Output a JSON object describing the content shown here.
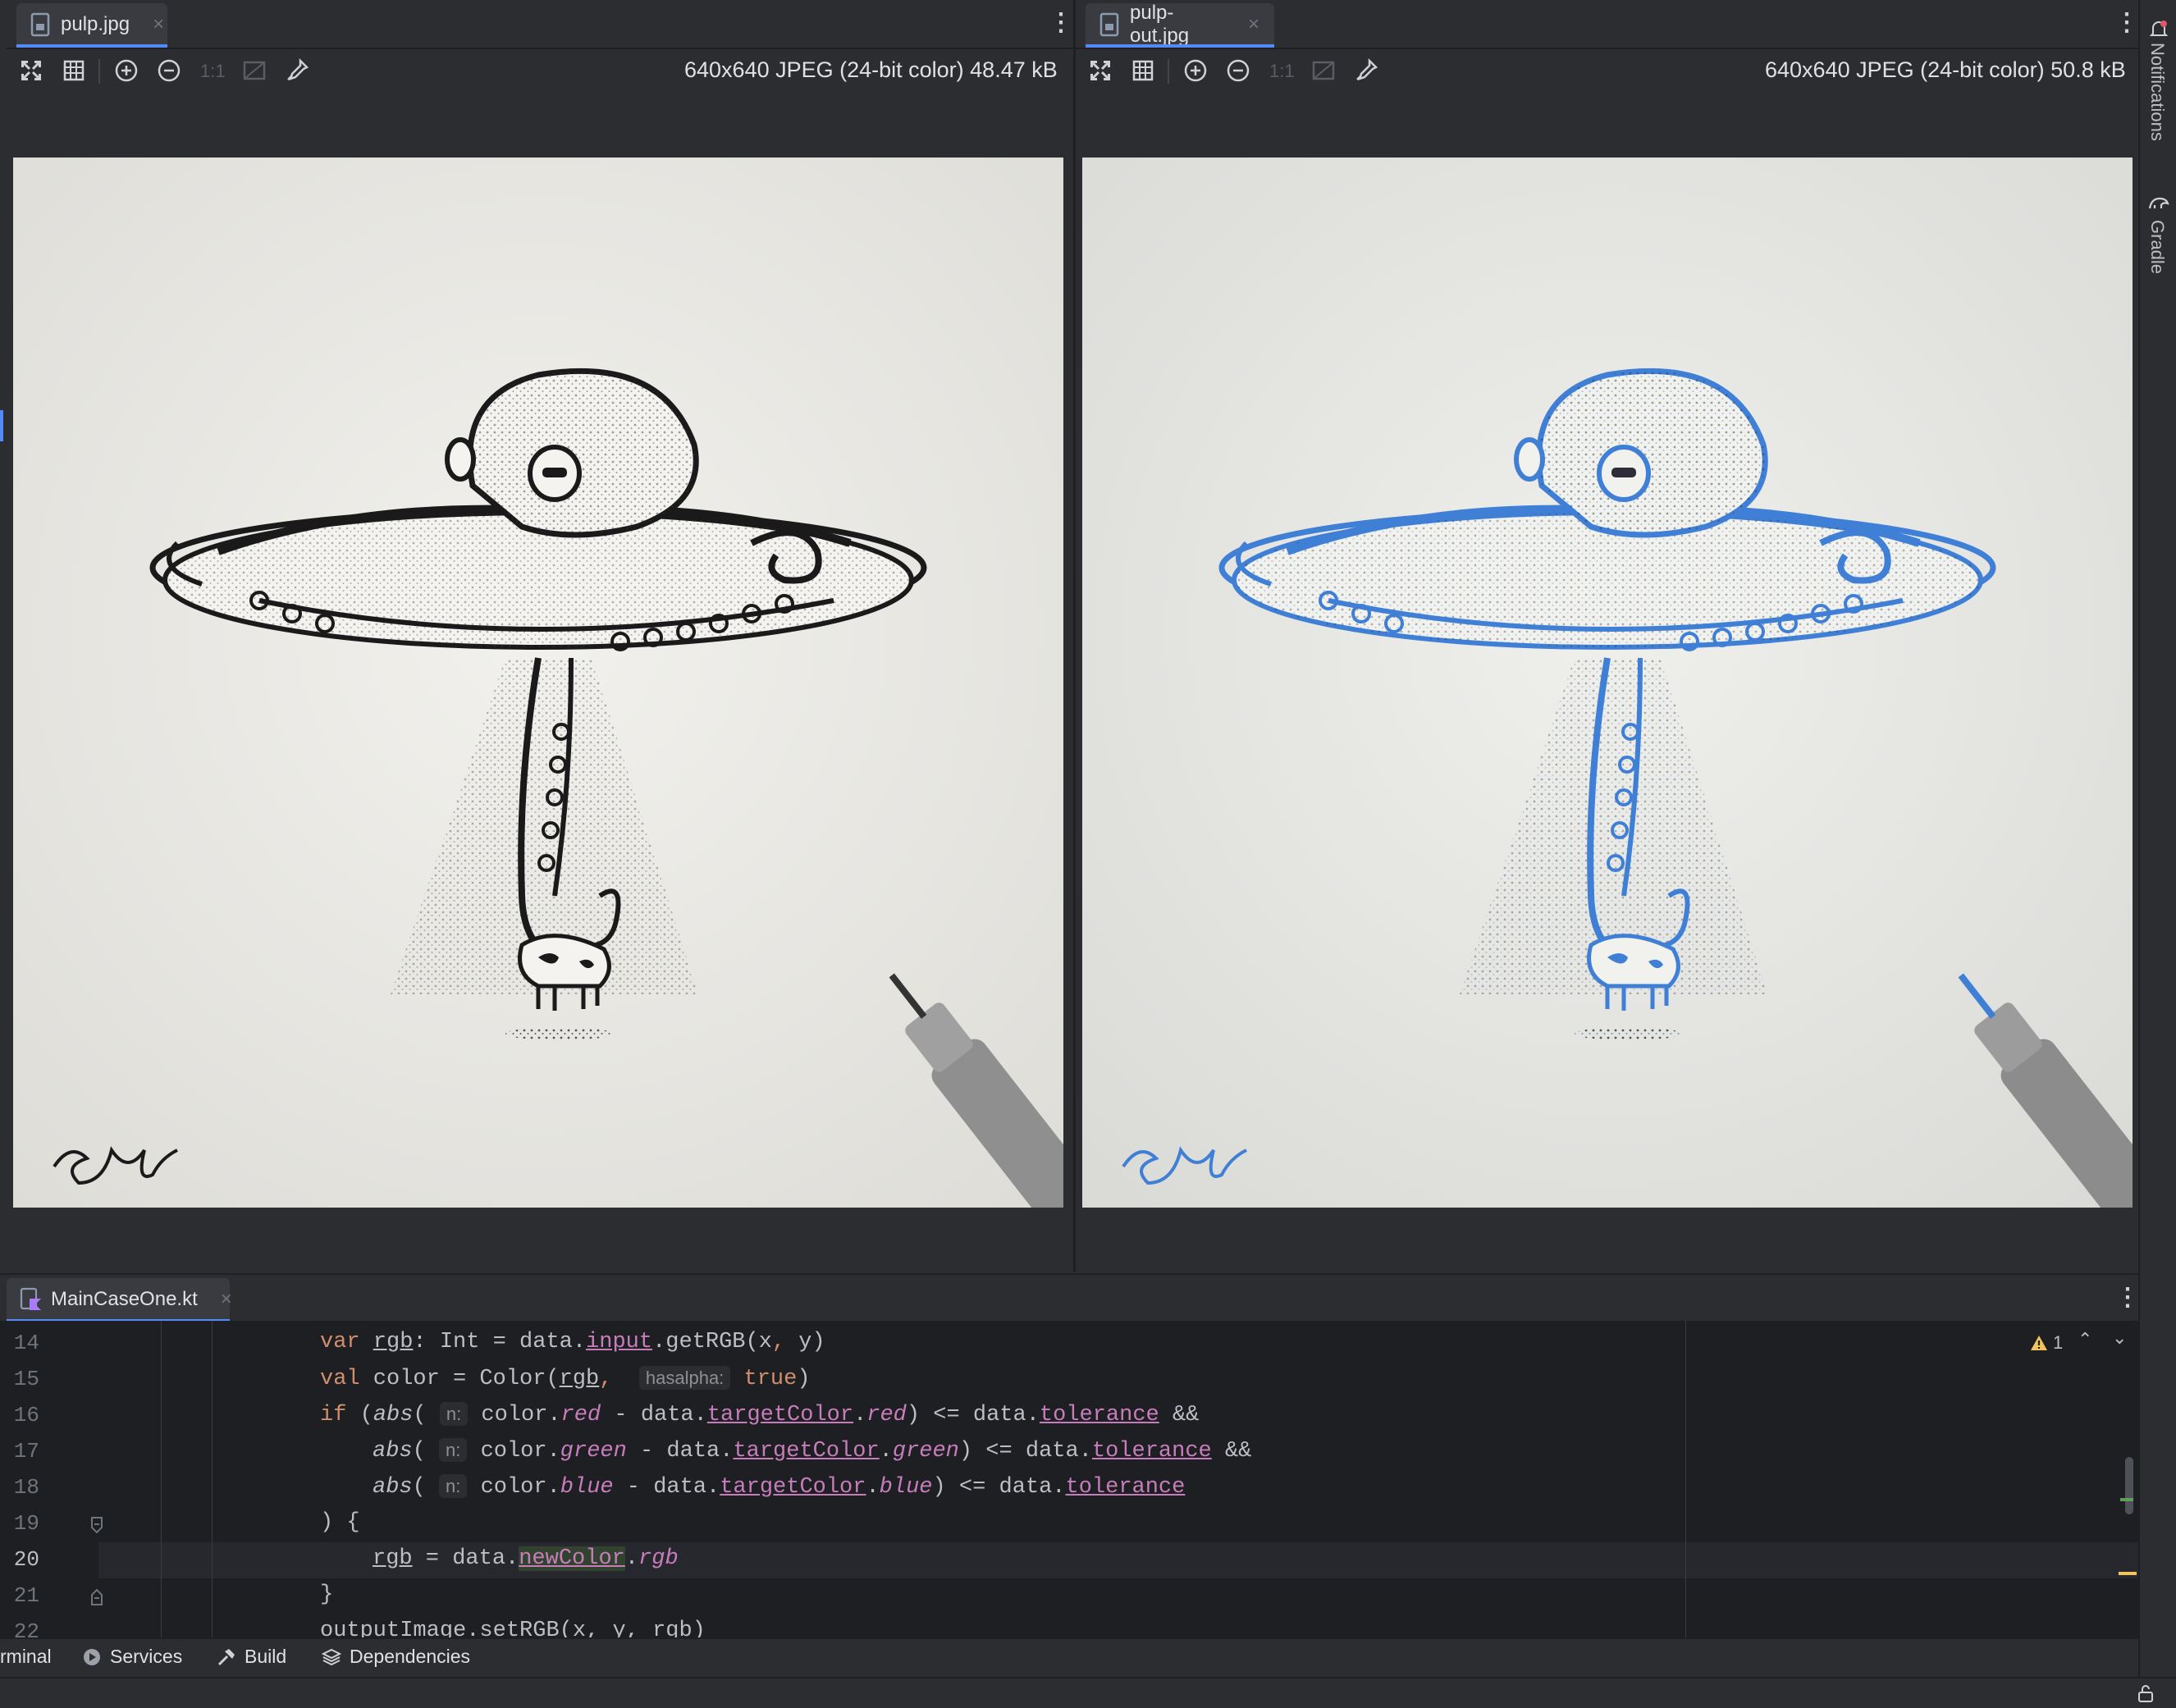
{
  "left_pane": {
    "tab_label": "pulp.jpg",
    "close_glyph": "×",
    "image_info": "640x640 JPEG (24-bit color) 48.47 kB",
    "zoom_actual_label": "1:1",
    "signature_ink": "#1a1a1a"
  },
  "right_pane": {
    "tab_label": "pulp-out.jpg",
    "close_glyph": "×",
    "image_info": "640x640 JPEG (24-bit color) 50.8 kB",
    "zoom_actual_label": "1:1",
    "signature_ink": "#3f7fd6"
  },
  "right_sidebar": {
    "notifications_label": "Notifications",
    "gradle_label": "Gradle"
  },
  "editor": {
    "tab_label": "MainCaseOne.kt",
    "close_glyph": "×",
    "warning_count": "1",
    "current_line": "20",
    "line_numbers": [
      "14",
      "15",
      "16",
      "17",
      "18",
      "19",
      "20",
      "21",
      "22"
    ],
    "lines": {
      "l14": {
        "kw": "var",
        "rgb": "rgb",
        "t1": ": Int = data.",
        "input": "input",
        "t2": ".",
        "getrgb": "getRGB",
        "t3": "(x",
        "comma": ",",
        "t4": " y)"
      },
      "l15": {
        "kw": "val",
        "t1": " color = Color(",
        "rgb": "rgb",
        "comma": ",",
        "hint": "hasalpha:",
        "true": "true",
        "t2": ")"
      },
      "l16": {
        "kw": "if",
        "t1": " (",
        "abs": "abs",
        "t2": "(",
        "hint": "n:",
        "t3": " color.",
        "red": "red",
        "t4": " - data.",
        "target": "targetColor",
        "t5": ".",
        "red2": "red",
        "t6": ") <= data.",
        "tol": "tolerance",
        "t7": " &&"
      },
      "l17": {
        "abs": "abs",
        "t2": "(",
        "hint": "n:",
        "t3": " color.",
        "green": "green",
        "t4": " - data.",
        "target": "targetColor",
        "t5": ".",
        "green2": "green",
        "t6": ") <= data.",
        "tol": "tolerance",
        "t7": " &&"
      },
      "l18": {
        "abs": "abs",
        "t2": "(",
        "hint": "n:",
        "t3": " color.",
        "blue": "blue",
        "t4": " - data.",
        "target": "targetColor",
        "t5": ".",
        "blue2": "blue",
        "t6": ") <= data.",
        "tol": "tolerance"
      },
      "l19": {
        "t1": ") {"
      },
      "l20": {
        "rgb": "rgb",
        "t1": " = data.",
        "newcolor": "newColor",
        "t2": ".",
        "rgbprop": "rgb"
      },
      "l21": {
        "t1": "}"
      },
      "l22": {
        "t1": "outputImage.setRGB(x, y, rgb)"
      }
    }
  },
  "bottom_bar": {
    "terminal_label": "rminal",
    "services_label": "Services",
    "build_label": "Build",
    "dependencies_label": "Dependencies"
  },
  "colors": {
    "accent": "#548af7",
    "warning": "#f2c55c",
    "out_tint": "#3f7fd6"
  }
}
